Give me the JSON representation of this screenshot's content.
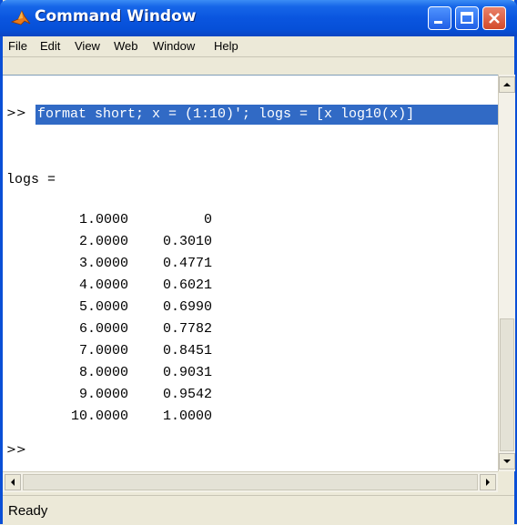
{
  "window": {
    "title": "Command Window",
    "title_icon": "matlab-logo-icon"
  },
  "menu": [
    "File",
    "Edit",
    "View",
    "Web",
    "Window",
    "Help"
  ],
  "command": {
    "prompt": ">>",
    "input": "format short; x = (1:10)'; logs = [x log10(x)]"
  },
  "output": {
    "variable_line": "logs =",
    "rows": [
      [
        "1.0000",
        "0"
      ],
      [
        "2.0000",
        "0.3010"
      ],
      [
        "3.0000",
        "0.4771"
      ],
      [
        "4.0000",
        "0.6021"
      ],
      [
        "5.0000",
        "0.6990"
      ],
      [
        "6.0000",
        "0.7782"
      ],
      [
        "7.0000",
        "0.8451"
      ],
      [
        "8.0000",
        "0.9031"
      ],
      [
        "9.0000",
        "0.9542"
      ],
      [
        "10.0000",
        "1.0000"
      ]
    ]
  },
  "final_prompt": ">>",
  "status": "Ready",
  "colors": {
    "titlebar": "#0a55df",
    "selection": "#316ac5",
    "close_button": "#d34a2a"
  }
}
